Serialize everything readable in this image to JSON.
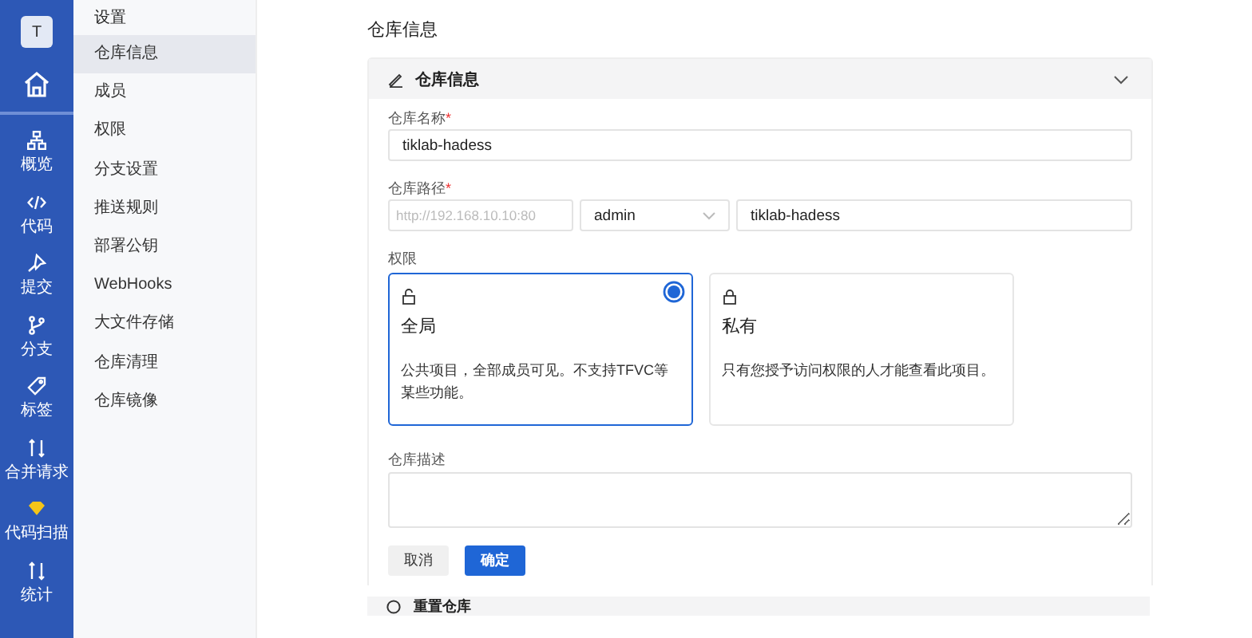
{
  "nav": {
    "avatar": "T",
    "items": [
      {
        "kind": "overview",
        "label": "概览"
      },
      {
        "kind": "code",
        "label": "代码"
      },
      {
        "kind": "commit",
        "label": "提交"
      },
      {
        "kind": "branch",
        "label": "分支"
      },
      {
        "kind": "tag",
        "label": "标签"
      },
      {
        "kind": "merge",
        "label": "合并请求"
      },
      {
        "kind": "scan",
        "label": "代码扫描"
      },
      {
        "kind": "stats",
        "label": "统计"
      }
    ]
  },
  "sidebar": {
    "title": "设置",
    "items": [
      {
        "label": "仓库信息",
        "selected": true
      },
      {
        "label": "成员",
        "selected": false
      },
      {
        "label": "权限",
        "selected": false
      },
      {
        "label": "分支设置",
        "selected": false
      },
      {
        "label": "推送规则",
        "selected": false
      },
      {
        "label": "部署公钥",
        "selected": false
      },
      {
        "label": "WebHooks",
        "selected": false
      },
      {
        "label": "大文件存储",
        "selected": false
      },
      {
        "label": "仓库清理",
        "selected": false
      },
      {
        "label": "仓库镜像",
        "selected": false
      }
    ]
  },
  "page_title": "仓库信息",
  "section": {
    "title": "仓库信息",
    "expanded": true
  },
  "name_field": {
    "label": "仓库名称",
    "required_mark": "*",
    "value": "tiklab-hadess"
  },
  "path_field": {
    "label": "仓库路径",
    "required_mark": "*",
    "base": "http://192.168.10.10:80",
    "owner": "admin",
    "name": "tiklab-hadess"
  },
  "permission": {
    "label": "权限",
    "options": [
      {
        "title": "全局",
        "description": "公共项目，全部成员可见。不支持TFVC等某些功能。",
        "selected": true
      },
      {
        "title": "私有",
        "description": "只有您授予访问权限的人才能查看此项目。",
        "selected": false
      }
    ]
  },
  "description_field": {
    "label": "仓库描述"
  },
  "buttons": {
    "cancel": "取消",
    "confirm": "确定"
  },
  "next_section": {
    "title": "重置仓库"
  }
}
